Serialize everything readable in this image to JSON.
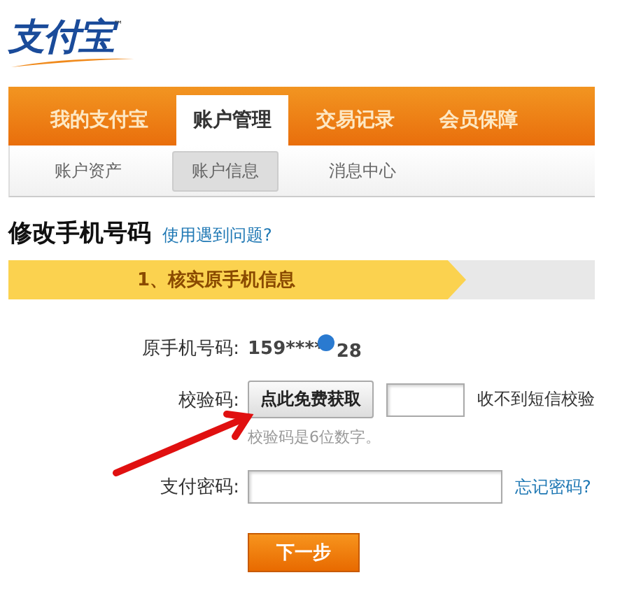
{
  "logo": {
    "text": "支付宝",
    "mark": "™"
  },
  "nav": {
    "tabs": [
      {
        "label": "我的支付宝",
        "selected": false
      },
      {
        "label": "账户管理",
        "selected": true
      },
      {
        "label": "交易记录",
        "selected": false
      },
      {
        "label": "会员保障",
        "selected": false
      }
    ],
    "subtabs": [
      {
        "label": "账户资产",
        "selected": false
      },
      {
        "label": "账户信息",
        "selected": true
      },
      {
        "label": "消息中心",
        "selected": false
      }
    ]
  },
  "heading": {
    "title": "修改手机号码",
    "help_link": "使用遇到问题?"
  },
  "steps": [
    {
      "label": "1、核实原手机信息",
      "selected": true
    }
  ],
  "form": {
    "phone": {
      "label": "原手机号码:",
      "value_start": "159****",
      "value_end": "28"
    },
    "code": {
      "label": "校验码:",
      "button": "点此免费获取",
      "note": "收不到短信校验",
      "hint": "校验码是6位数字。"
    },
    "password": {
      "label": "支付密码:",
      "link": "忘记密码?"
    },
    "submit": "下一步"
  }
}
